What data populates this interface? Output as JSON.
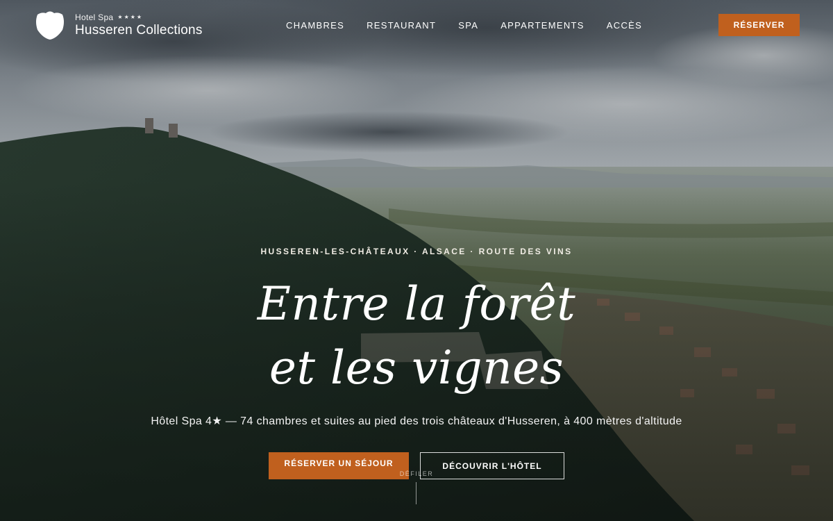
{
  "colors": {
    "accent": "#c0601e",
    "text": "#ffffff"
  },
  "brand": {
    "line1": "Hotel Spa",
    "stars": "★★★★",
    "name": "Husseren Collections",
    "logo_icon": "shield-crest-icon"
  },
  "nav": {
    "items": [
      {
        "label": "CHAMBRES"
      },
      {
        "label": "RESTAURANT"
      },
      {
        "label": "SPA"
      },
      {
        "label": "APPARTEMENTS"
      },
      {
        "label": "ACCÈS"
      }
    ],
    "reserve_label": "RÉSERVER"
  },
  "hero": {
    "eyebrow": "HUSSEREN-LES-CHÂTEAUX · ALSACE · ROUTE DES VINS",
    "title_line1": "Entre la forêt",
    "title_line2": "et les vignes",
    "subtitle": "Hôtel Spa 4★ — 74 chambres et suites au pied des trois châteaux d'Husseren, à 400 mètres d'altitude",
    "cta_primary": "RÉSERVER UN SÉJOUR",
    "cta_secondary": "DÉCOUVRIR L'HÔTEL",
    "scroll_label": "DÉFILER"
  }
}
